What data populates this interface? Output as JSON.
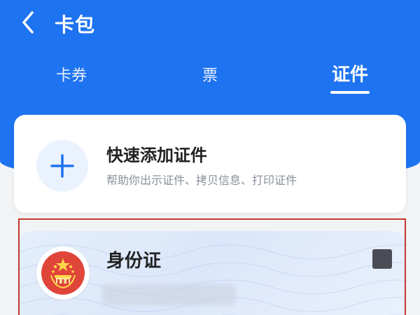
{
  "header": {
    "title": "卡包",
    "back_icon": "chevron-left-icon"
  },
  "tabs": [
    {
      "label": "卡券",
      "active": false
    },
    {
      "label": "票",
      "active": false
    },
    {
      "label": "证件",
      "active": true
    }
  ],
  "quick_add": {
    "icon": "plus-icon",
    "title": "快速添加证件",
    "subtitle": "帮助你出示证件、拷贝信息、打印证件"
  },
  "id_card": {
    "title": "身份证",
    "emblem_icon": "national-emblem-icon",
    "menu_icon": "more-icon"
  },
  "colors": {
    "primary": "#1e73f0",
    "background": "#f2f3f5",
    "highlight": "#c0392b",
    "emblem_red": "#e0453a"
  }
}
